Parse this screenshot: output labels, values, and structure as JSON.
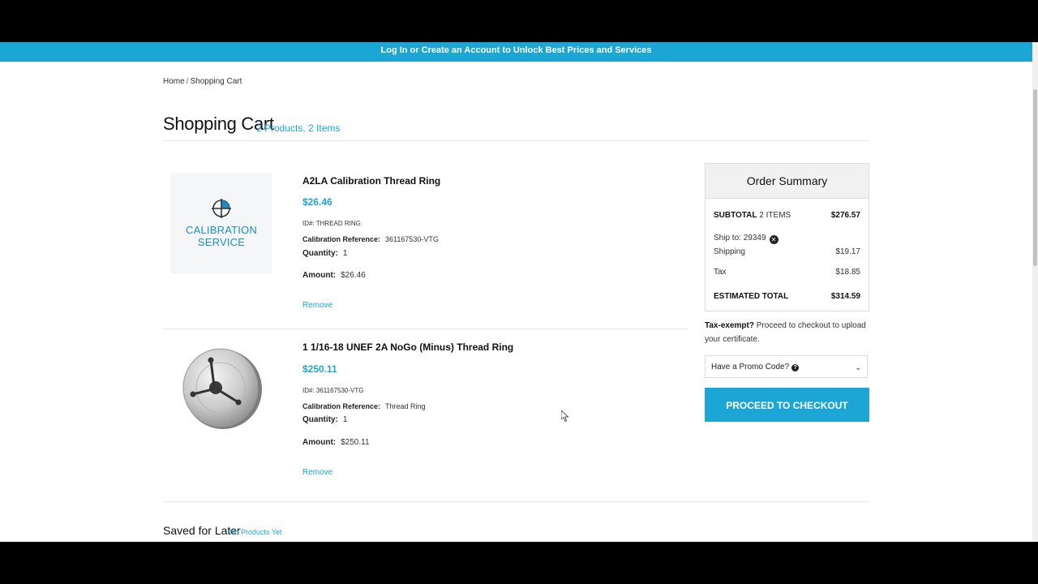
{
  "banner": {
    "text": "Log In or Create an Account to Unlock Best Prices and Services"
  },
  "breadcrumb": {
    "home": "Home",
    "separator": "/",
    "current": "Shopping Cart"
  },
  "cart": {
    "title": "Shopping Cart",
    "subtitle": "2 Products, 2 Items",
    "items": [
      {
        "name": "A2LA Calibration Thread Ring",
        "price": "$26.46",
        "id_label": "ID#:",
        "id_value": "THREAD RING",
        "ref_label": "Calibration Reference:",
        "ref_value": "361167530-VTG",
        "qty_label": "Quantity:",
        "qty_value": "1",
        "amount_label": "Amount:",
        "amount_value": "$26.46",
        "remove": "Remove",
        "image_text": [
          "CALIBRATION",
          "SERVICE"
        ]
      },
      {
        "name": "1 1/16-18 UNEF 2A NoGo (Minus) Thread Ring",
        "price": "$250.11",
        "id_label": "ID#:",
        "id_value": "361167530-VTG",
        "ref_label": "Calibration Reference:",
        "ref_value": "Thread Ring",
        "qty_label": "Quantity:",
        "qty_value": "1",
        "amount_label": "Amount:",
        "amount_value": "$250.11",
        "remove": "Remove"
      }
    ]
  },
  "summary": {
    "title": "Order Summary",
    "subtotal_label": "SUBTOTAL",
    "subtotal_items": "2 ITEMS",
    "subtotal_value": "$276.57",
    "ship_to_label": "Ship to:",
    "ship_to_zip": "29349",
    "shipping_label": "Shipping",
    "shipping_value": "$19.17",
    "tax_label": "Tax",
    "tax_value": "$18.85",
    "total_label": "ESTIMATED TOTAL",
    "total_value": "$314.59"
  },
  "tax_exempt": {
    "bold": "Tax-exempt?",
    "text": "Proceed to checkout to upload your certificate."
  },
  "promo": {
    "label": "Have a Promo Code?"
  },
  "checkout": {
    "label": "PROCEED TO CHECKOUT"
  },
  "saved": {
    "title": "Saved for Later",
    "subtitle": "No Products Yet"
  },
  "colors": {
    "accent": "#1ba6d6",
    "banner": "#1ba6d6",
    "summary_header": "#f1f1f1"
  },
  "icons": [
    "calibration-crosshair-icon",
    "close-circle-icon",
    "question-circle-icon",
    "chevron-down-icon",
    "mouse-cursor-icon"
  ]
}
